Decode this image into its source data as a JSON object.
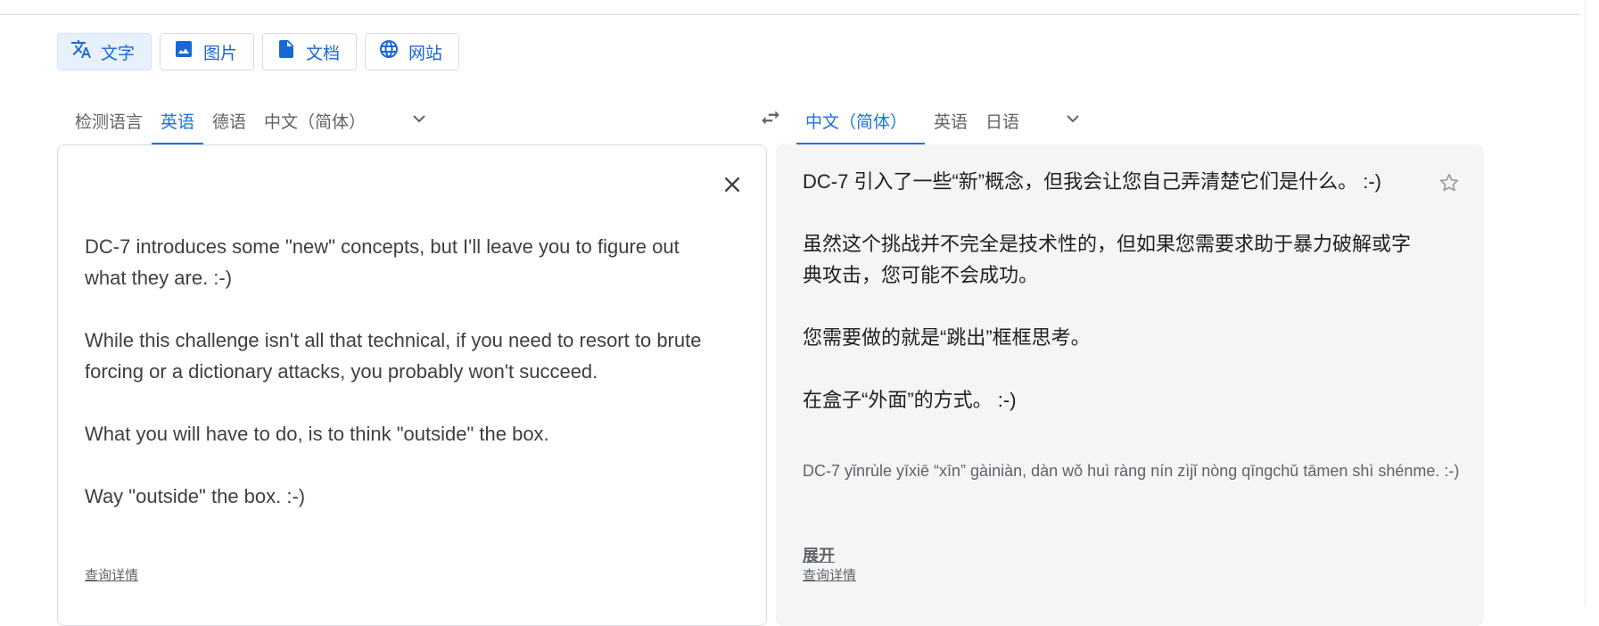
{
  "mode_tabs": [
    {
      "label": "文字",
      "icon": "translate-icon",
      "active": true
    },
    {
      "label": "图片",
      "icon": "image-icon",
      "active": false
    },
    {
      "label": "文档",
      "icon": "document-icon",
      "active": false
    },
    {
      "label": "网站",
      "icon": "globe-icon",
      "active": false
    }
  ],
  "source_languages": {
    "tabs": [
      {
        "label": "检测语言",
        "active": false
      },
      {
        "label": "英语",
        "active": true
      },
      {
        "label": "德语",
        "active": false
      },
      {
        "label": "中文（简体）",
        "active": false
      }
    ],
    "more_icon": "chevron-down-icon"
  },
  "target_languages": {
    "tabs": [
      {
        "label": "中文（简体）",
        "active": true
      },
      {
        "label": "英语",
        "active": false
      },
      {
        "label": "日语",
        "active": false
      }
    ],
    "more_icon": "chevron-down-icon"
  },
  "swap_icon": "swap-icon",
  "source": {
    "paragraphs": [
      "DC-7 introduces some \"new\" concepts, but I'll leave you to figure out what they are.  :-)",
      "While this challenge isn't all that technical, if you need to resort to brute forcing or a dictionary attacks, you probably won't succeed.",
      "What you will have to do, is to think \"outside\" the box.",
      "Way \"outside\" the box.  :-)"
    ],
    "detail_link": "查询详情",
    "clear_icon": "close-icon"
  },
  "target": {
    "paragraphs": [
      "DC-7 引入了一些“新”概念，但我会让您自己弄清楚它们是什么。 :-)",
      "虽然这个挑战并不完全是技术性的，但如果您需要求助于暴力破解或字典攻击，您可能不会成功。",
      "您需要做的就是“跳出”框框思考。",
      "在盒子“外面”的方式。 :-)"
    ],
    "pinyin": "DC-7 yǐnrùle yīxiē “xīn” gàiniàn, dàn wǒ huì ràng nín zìjǐ nòng qīngchǔ tāmen shì shénme. :-)",
    "expand": "展开",
    "detail_link": "查询详情",
    "star_icon": "star-outline-icon"
  },
  "colors": {
    "accent": "#1a73e8",
    "active_mode_bg": "#e8f0fe",
    "target_panel_bg": "#f5f5f5"
  }
}
